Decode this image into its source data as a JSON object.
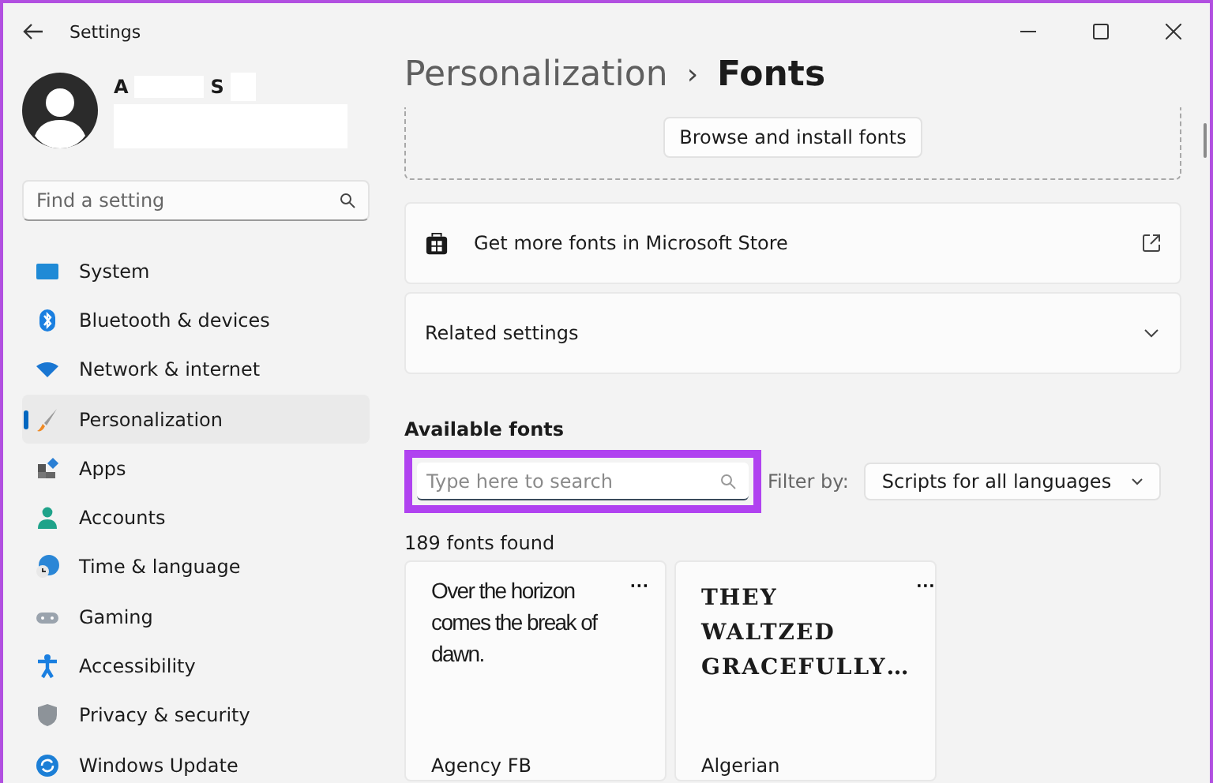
{
  "window": {
    "title": "Settings"
  },
  "profile": {
    "name_parts": [
      "A",
      "S"
    ]
  },
  "sidebar": {
    "search": {
      "placeholder": "Find a setting"
    },
    "items": [
      {
        "label": "System",
        "selected": false
      },
      {
        "label": "Bluetooth & devices",
        "selected": false
      },
      {
        "label": "Network & internet",
        "selected": false
      },
      {
        "label": "Personalization",
        "selected": true
      },
      {
        "label": "Apps",
        "selected": false
      },
      {
        "label": "Accounts",
        "selected": false
      },
      {
        "label": "Time & language",
        "selected": false
      },
      {
        "label": "Gaming",
        "selected": false
      },
      {
        "label": "Accessibility",
        "selected": false
      },
      {
        "label": "Privacy & security",
        "selected": false
      },
      {
        "label": "Windows Update",
        "selected": false
      }
    ]
  },
  "breadcrumb": {
    "parent": "Personalization",
    "separator": "›",
    "current": "Fonts"
  },
  "drop_area": {
    "button": "Browse and install fonts"
  },
  "store_link": {
    "label": "Get more fonts in Microsoft Store"
  },
  "related": {
    "label": "Related settings",
    "expanded": false
  },
  "available": {
    "heading": "Available fonts",
    "search": {
      "placeholder": "Type here to search",
      "highlighted": true
    },
    "filter_label": "Filter by:",
    "filter_value": "Scripts for all languages",
    "count": "189 fonts found",
    "fonts": [
      {
        "kind": "narrow",
        "sample": "Over the horizon comes the break of dawn.",
        "more": "···",
        "name": "Agency FB"
      },
      {
        "kind": "display",
        "sample": "THEY WALTZED GRACEFULLY…",
        "more": "···",
        "name": "Algerian"
      }
    ]
  }
}
